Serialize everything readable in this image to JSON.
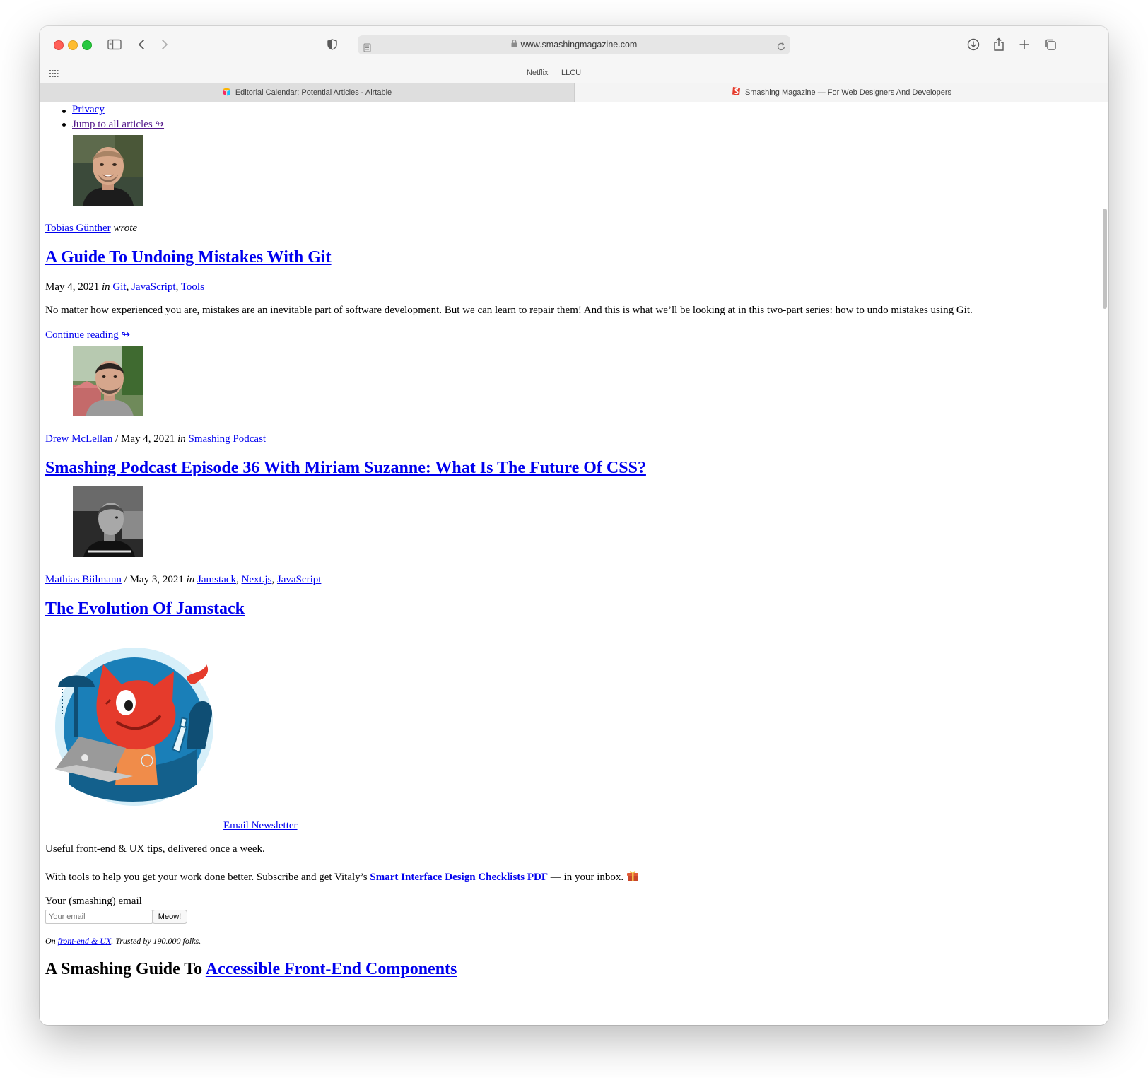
{
  "browser": {
    "url": "www.smashingmagazine.com",
    "favorites": [
      "Netflix",
      "LLCU"
    ],
    "tabs": [
      {
        "title": "Editorial Calendar: Potential Articles - Airtable"
      },
      {
        "title": "Smashing Magazine — For Web Designers And Developers"
      }
    ]
  },
  "nav_list": {
    "privacy": "Privacy",
    "jump": "Jump to all articles ↬"
  },
  "article1": {
    "author": "Tobias Günther",
    "wrote": "wrote",
    "title": "A Guide To Undoing Mistakes With Git",
    "date": "May 4, 2021",
    "in": "in",
    "tags": [
      "Git",
      "JavaScript",
      "Tools"
    ],
    "excerpt": "No matter how experienced you are, mistakes are an inevitable part of software development. But we can learn to repair them! And this is what we’ll be looking at in this two-part series: how to undo mistakes using Git.",
    "continue": "Continue reading ↬"
  },
  "article2": {
    "author": "Drew McLellan",
    "sep": "/ May 4, 2021",
    "in": "in",
    "tags": [
      "Smashing Podcast"
    ],
    "title": "Smashing Podcast Episode 36 With Miriam Suzanne: What Is The Future Of CSS?"
  },
  "article3": {
    "author": "Mathias Biilmann",
    "sep": "/ May 3, 2021",
    "in": "in",
    "tags": [
      "Jamstack",
      "Next.js",
      "JavaScript"
    ],
    "title": "The Evolution Of Jamstack"
  },
  "newsletter": {
    "link": "Email Newsletter",
    "tagline": "Useful front-end & UX tips, delivered once a week.",
    "pitch_before": "With tools to help you get your work done better. Subscribe and get Vitaly’s",
    "pitch_link": "Smart Interface Design Checklists PDF",
    "pitch_after": "— in your inbox.",
    "label": "Your (smashing) email",
    "placeholder": "Your email",
    "button": "Meow!",
    "trust_on": "On",
    "trust_link": "front-end & UX",
    "trust_after": ". Trusted by 190.000 folks."
  },
  "guide": {
    "prefix": "A Smashing Guide To",
    "link": "Accessible Front-End Components"
  },
  "colors": {
    "link": "#0000ee",
    "visited": "#551a8b",
    "mascot_red": "#e53b2c",
    "mascot_bg": "#d6eff9",
    "mascot_blue": "#1a7fb8"
  }
}
